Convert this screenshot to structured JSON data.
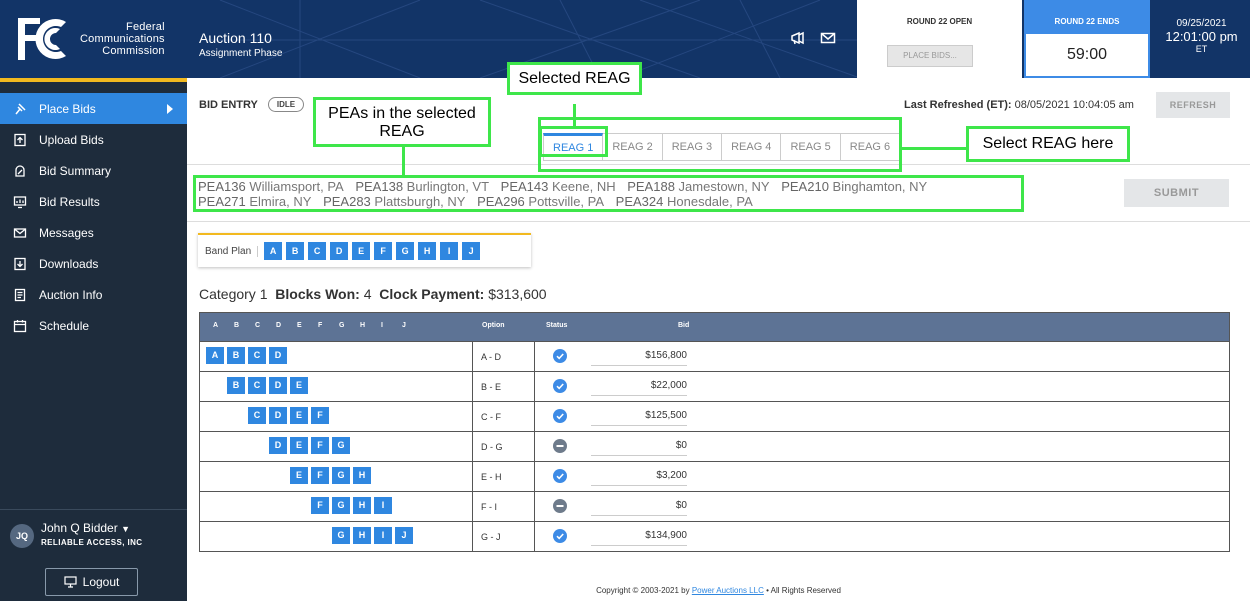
{
  "header": {
    "org_name_lines": [
      "Federal",
      "Communications",
      "Commission"
    ],
    "auction_title": "Auction 110",
    "auction_phase": "Assignment Phase",
    "round_open_label": "ROUND 22 OPEN",
    "place_bids_label": "PLACE BIDS...",
    "round_ends_label": "ROUND 22 ENDS",
    "timer": "59:00",
    "date": "09/25/2021",
    "time": "12:01:00 pm",
    "zone": "ET",
    "icons": [
      "megaphone-icon",
      "mail-icon"
    ]
  },
  "sidebar": {
    "items": [
      {
        "label": "Place Bids",
        "icon": "hand-bid-icon",
        "active": true
      },
      {
        "label": "Upload Bids",
        "icon": "upload-icon",
        "active": false
      },
      {
        "label": "Bid Summary",
        "icon": "summary-icon",
        "active": false
      },
      {
        "label": "Bid Results",
        "icon": "results-icon",
        "active": false
      },
      {
        "label": "Messages",
        "icon": "mail-icon",
        "active": false
      },
      {
        "label": "Downloads",
        "icon": "download-icon",
        "active": false
      },
      {
        "label": "Auction Info",
        "icon": "info-icon",
        "active": false
      },
      {
        "label": "Schedule",
        "icon": "calendar-icon",
        "active": false
      }
    ],
    "user": {
      "initials": "JQ",
      "name": "John Q Bidder",
      "org": "RELIABLE ACCESS, INC"
    },
    "logout_label": "Logout"
  },
  "main": {
    "bid_entry_label": "BID ENTRY",
    "status_pill": "IDLE",
    "last_refreshed_label": "Last Refreshed (ET):",
    "last_refreshed_value": "08/05/2021 10:04:05 am",
    "refresh_label": "REFRESH",
    "submit_label": "SUBMIT",
    "tabs": [
      "REAG 1",
      "REAG 2",
      "REAG 3",
      "REAG 4",
      "REAG 5",
      "REAG 6"
    ],
    "active_tab": 0,
    "peas": [
      {
        "code": "PEA136",
        "name": "Williamsport, PA"
      },
      {
        "code": "PEA138",
        "name": "Burlington, VT"
      },
      {
        "code": "PEA143",
        "name": "Keene, NH"
      },
      {
        "code": "PEA188",
        "name": "Jamestown, NY"
      },
      {
        "code": "PEA210",
        "name": "Binghamton, NY"
      },
      {
        "code": "PEA271",
        "name": "Elmira, NY"
      },
      {
        "code": "PEA283",
        "name": "Plattsburgh, NY"
      },
      {
        "code": "PEA296",
        "name": "Pottsville, PA"
      },
      {
        "code": "PEA324",
        "name": "Honesdale, PA"
      }
    ],
    "band_plan_label": "Band Plan",
    "bands": [
      "A",
      "B",
      "C",
      "D",
      "E",
      "F",
      "G",
      "H",
      "I",
      "J"
    ],
    "category": {
      "label": "Category 1",
      "blocks_won_label": "Blocks Won:",
      "blocks_won": "4",
      "clock_payment_label": "Clock Payment:",
      "clock_payment": "$313,600"
    },
    "table": {
      "headers": {
        "option": "Option",
        "status": "Status",
        "bid": "Bid"
      },
      "rows": [
        {
          "blocks": [
            "A",
            "B",
            "C",
            "D"
          ],
          "start": 0,
          "option": "A - D",
          "status": "check",
          "bid": "$156,800"
        },
        {
          "blocks": [
            "B",
            "C",
            "D",
            "E"
          ],
          "start": 1,
          "option": "B - E",
          "status": "check",
          "bid": "$22,000"
        },
        {
          "blocks": [
            "C",
            "D",
            "E",
            "F"
          ],
          "start": 2,
          "option": "C - F",
          "status": "check",
          "bid": "$125,500"
        },
        {
          "blocks": [
            "D",
            "E",
            "F",
            "G"
          ],
          "start": 3,
          "option": "D - G",
          "status": "none",
          "bid": "$0"
        },
        {
          "blocks": [
            "E",
            "F",
            "G",
            "H"
          ],
          "start": 4,
          "option": "E - H",
          "status": "check",
          "bid": "$3,200"
        },
        {
          "blocks": [
            "F",
            "G",
            "H",
            "I"
          ],
          "start": 5,
          "option": "F - I",
          "status": "none",
          "bid": "$0"
        },
        {
          "blocks": [
            "G",
            "H",
            "I",
            "J"
          ],
          "start": 6,
          "option": "G - J",
          "status": "check",
          "bid": "$134,900"
        }
      ]
    },
    "copyright_prefix": "Copyright © 2003-2021 by",
    "copyright_link": "Power Auctions LLC",
    "copyright_suffix": "• All Rights Reserved"
  },
  "annotations": {
    "selected_reag": "Selected REAG",
    "peas_in_reag": "PEAs in the selected REAG",
    "select_reag_here": "Select REAG here",
    "color": "#3ee64a"
  },
  "colors": {
    "header_bg": "#123467",
    "sidebar_bg": "#1e2c3c",
    "accent_blue": "#2f87e0",
    "accent_yellow": "#f2b91f",
    "table_head": "#5d7395"
  }
}
